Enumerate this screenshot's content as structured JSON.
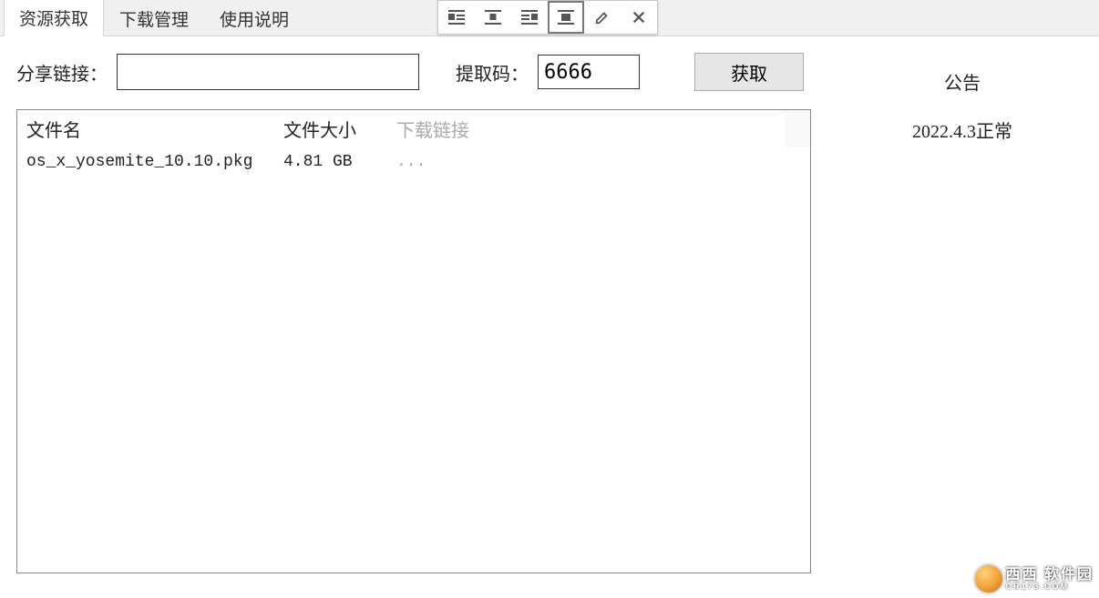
{
  "tabs": {
    "items": [
      {
        "label": "资源获取",
        "active": true
      },
      {
        "label": "下载管理",
        "active": false
      },
      {
        "label": "使用说明",
        "active": false
      }
    ]
  },
  "toolbar": {
    "items": [
      {
        "name": "align-wrap-left-icon",
        "active": false
      },
      {
        "name": "align-wrap-center-icon",
        "active": false
      },
      {
        "name": "align-wrap-right-icon",
        "active": false
      },
      {
        "name": "align-wrap-full-icon",
        "active": true
      },
      {
        "name": "edit-icon",
        "active": false
      },
      {
        "name": "close-icon",
        "active": false
      }
    ]
  },
  "form": {
    "share_label": "分享链接：",
    "share_value": "",
    "code_label": "提取码：",
    "code_value": "6666",
    "fetch_label": "获取"
  },
  "table": {
    "columns": {
      "name": "文件名",
      "size": "文件大小",
      "link": "下载链接"
    },
    "rows": [
      {
        "name": "os_x_yosemite_10.10.pkg",
        "size": "4.81 GB",
        "link": "..."
      }
    ]
  },
  "sidebar": {
    "title": "公告",
    "notice": "2022.4.3正常"
  },
  "watermark": {
    "line1": "西西 软件园",
    "line2": "CR173.COM"
  }
}
